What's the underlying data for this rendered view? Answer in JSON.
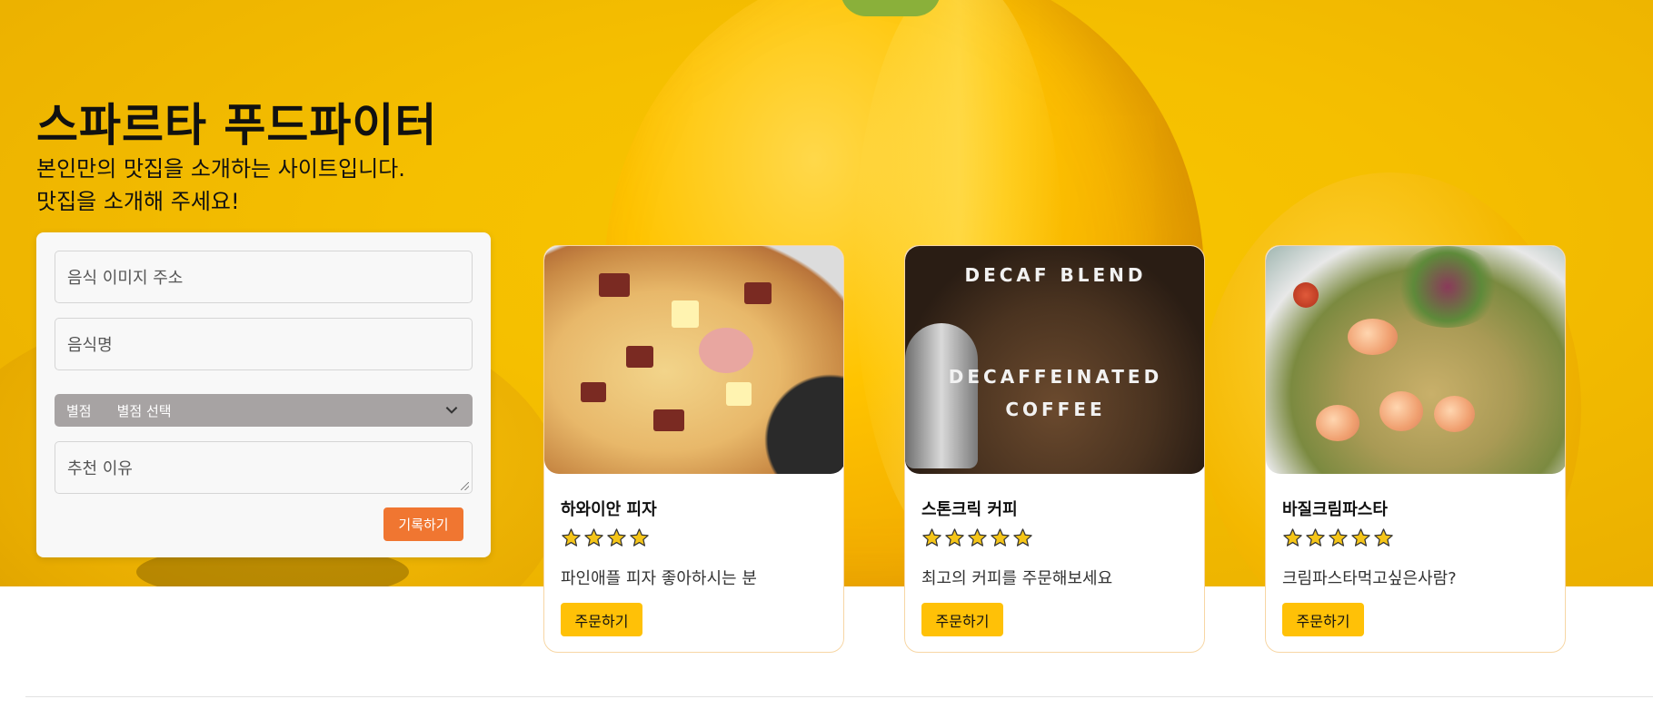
{
  "header": {
    "title": "스파르타 푸드파이터",
    "subtitle_line1": "본인만의 맛집을 소개하는 사이트입니다.",
    "subtitle_line2": "맛집을 소개해 주세요!"
  },
  "form": {
    "image_url_placeholder": "음식 이미지 주소",
    "food_name_placeholder": "음식명",
    "rating_label": "별점",
    "rating_selected": "별점 선택",
    "reason_placeholder": "추천 이유",
    "submit_label": "기록하기"
  },
  "cards": [
    {
      "name": "하와이안 피자",
      "rating": 4,
      "rating_max": 4,
      "description": "파인애플 피자 좋아하시는 분",
      "order_label": "주문하기"
    },
    {
      "name": "스톤크릭 커피",
      "rating": 5,
      "rating_max": 5,
      "description": "최고의 커피를 주문해보세요",
      "order_label": "주문하기",
      "image_text_top": "DECAF BLEND",
      "image_text_mid1": "DECAFFEINATED",
      "image_text_mid2": "COFFEE"
    },
    {
      "name": "바질크림파스타",
      "rating": 5,
      "rating_max": 5,
      "description": "크림파스타먹고싶은사람?",
      "order_label": "주문하기"
    }
  ],
  "colors": {
    "accent_submit": "#f07631",
    "accent_order": "#ffc107",
    "star_fill": "#f5c518",
    "select_bg": "#a7a3a3",
    "card_border": "#f7d6a4"
  }
}
